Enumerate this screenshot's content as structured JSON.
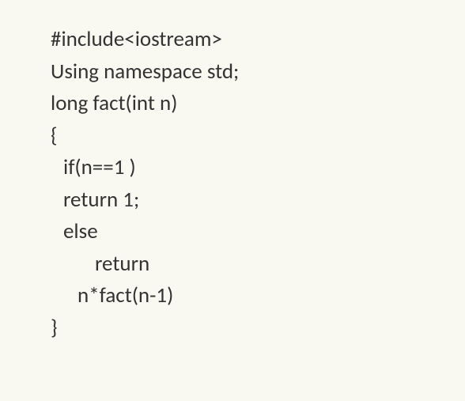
{
  "code": {
    "l1": "#include<iostream>",
    "l2": "Using namespace std;",
    "l3": "long fact(int n)",
    "l4": "{",
    "l5": "if(n==1 )",
    "l6": "return 1;",
    "l7": "else",
    "l8": "return",
    "l9": "n*fact(n-1)",
    "l10": "}"
  }
}
